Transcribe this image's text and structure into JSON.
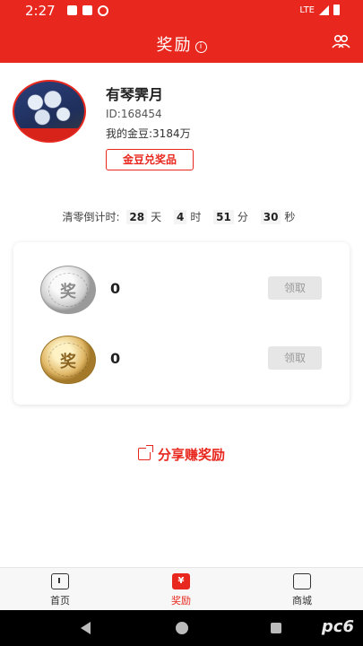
{
  "status_bar": {
    "time": "2:27",
    "network": "LTE"
  },
  "header": {
    "title": "奖励",
    "info_icon": "info-circle-icon",
    "right_icon": "group-icon"
  },
  "profile": {
    "name": "有琴霁月",
    "id_text": "ID:168454",
    "gold_text": "我的金豆:3184万",
    "redeem_label": "金豆兑奖品"
  },
  "countdown": {
    "label": "清零倒计时:",
    "days": "28",
    "days_unit": "天",
    "hours": "4",
    "hours_unit": "时",
    "minutes": "51",
    "minutes_unit": "分",
    "seconds": "30",
    "seconds_unit": "秒"
  },
  "rewards": [
    {
      "medal": "silver",
      "glyph": "奖",
      "count": "0",
      "claim_label": "领取"
    },
    {
      "medal": "gold",
      "glyph": "奖",
      "count": "0",
      "claim_label": "领取"
    }
  ],
  "share_label": "分享赚奖励",
  "tabs": [
    {
      "label": "首页",
      "icon": "home-icon"
    },
    {
      "label": "奖励",
      "icon": "yuan-icon",
      "active": true
    },
    {
      "label": "商城",
      "icon": "shopping-bag-icon"
    }
  ],
  "colors": {
    "brand": "#e8281e",
    "disabled_button": "#e6e6e6"
  },
  "watermark": "pc6"
}
